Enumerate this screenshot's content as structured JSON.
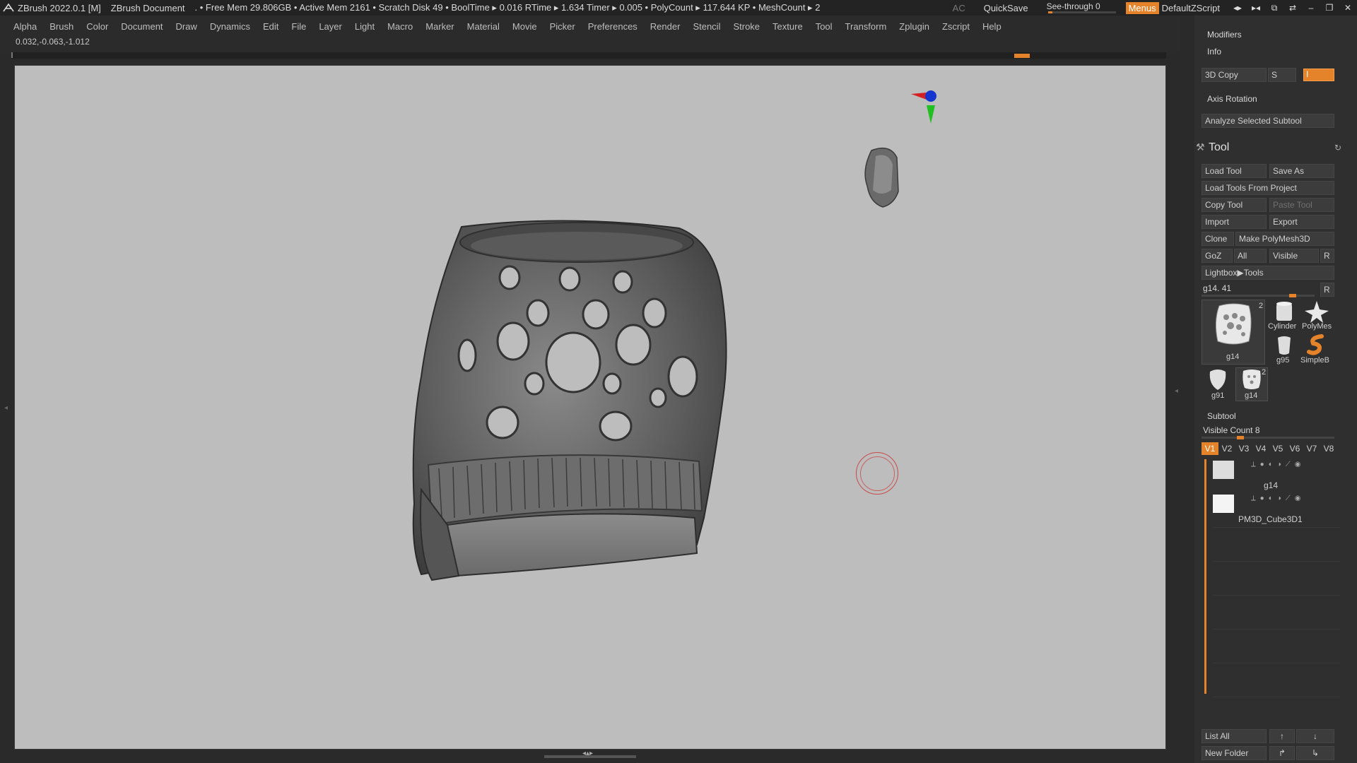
{
  "titlebar": {
    "app": "ZBrush 2022.0.1 [M]",
    "document": "ZBrush Document",
    "stats": ". • Free Mem 29.806GB • Active Mem 2161 • Scratch Disk 49 •  BoolTime ▸ 0.016 RTime ▸ 1.634 Timer ▸ 0.005 • PolyCount ▸ 117.644 KP  • MeshCount ▸ 2",
    "ac": "AC",
    "quicksave": "QuickSave",
    "seethrough_label": "See-through",
    "seethrough_value": "0",
    "seethrough_level": 0.0,
    "menus": "Menus",
    "default_zscript": "DefaultZScript"
  },
  "menubar": {
    "items": [
      "Alpha",
      "Brush",
      "Color",
      "Document",
      "Draw",
      "Dynamics",
      "Edit",
      "File",
      "Layer",
      "Light",
      "Macro",
      "Marker",
      "Material",
      "Movie",
      "Picker",
      "Preferences",
      "Render",
      "Stencil",
      "Stroke",
      "Texture",
      "Tool",
      "Transform",
      "Zplugin",
      "Zscript",
      "Help"
    ]
  },
  "coords": "0.032,-0.063,-1.012",
  "right_panel": {
    "modifiers": "Modifiers",
    "info": "Info",
    "copy3d": "3D Copy",
    "s_label": "S",
    "i_label": "I",
    "axis_rotation": "Axis Rotation",
    "analyze": "Analyze Selected Subtool",
    "tool_title": "Tool",
    "load_tool": "Load Tool",
    "save_as": "Save As",
    "load_from_project": "Load Tools From Project",
    "copy_tool": "Copy Tool",
    "paste_tool": "Paste Tool",
    "import": "Import",
    "export": "Export",
    "clone": "Clone",
    "make_polymesh": "Make PolyMesh3D",
    "goz": "GoZ",
    "all": "All",
    "visible": "Visible",
    "r": "R",
    "lightbox_tools": "Lightbox▶Tools",
    "tool_slider_label": "g14. 41",
    "tool_slider_r": "R",
    "tool_thumbs": {
      "main": "g14",
      "main_count": "2",
      "cylinder": "Cylinder",
      "polymesh": "PolyMes",
      "g95": "g95",
      "simpleb": "SimpleB",
      "g91": "g91",
      "g14b": "g14",
      "g14b_count": "2"
    },
    "subtool_title": "Subtool",
    "visible_count": "Visible Count 8",
    "vtabs": [
      "V1",
      "V2",
      "V3",
      "V4",
      "V5",
      "V6",
      "V7",
      "V8"
    ],
    "subtools": [
      {
        "name": "g14"
      },
      {
        "name": "PM3D_Cube3D1"
      }
    ],
    "list_all": "List All",
    "new_folder": "New Folder"
  },
  "colors": {
    "accent": "#e5832a",
    "canvas_bg": "#bdbdbd",
    "panel_bg": "#2f2f2f"
  }
}
